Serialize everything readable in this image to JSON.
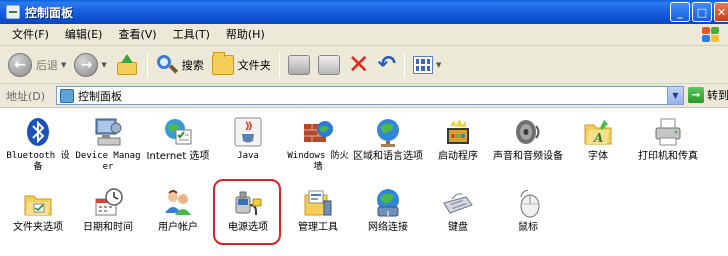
{
  "window": {
    "title": "控制面板"
  },
  "menubar": {
    "items": [
      "文件(F)",
      "编辑(E)",
      "查看(V)",
      "工具(T)",
      "帮助(H)"
    ]
  },
  "toolbar": {
    "back_label": "后退",
    "search_label": "搜索",
    "folders_label": "文件夹"
  },
  "address": {
    "label": "地址(D)",
    "value": "控制面板",
    "go_label": "转到"
  },
  "items": [
    {
      "label": "Bluetooth 设备",
      "icon": "bluetooth-icon"
    },
    {
      "label": "Device Manager",
      "icon": "device-manager-icon"
    },
    {
      "label": "Internet 选项",
      "icon": "internet-options-icon"
    },
    {
      "label": "Java",
      "icon": "java-icon"
    },
    {
      "label": "Windows 防火墙",
      "icon": "firewall-icon"
    },
    {
      "label": "区域和语言选项",
      "icon": "region-language-icon"
    },
    {
      "label": "启动程序",
      "icon": "startup-programs-icon"
    },
    {
      "label": "声音和音频设备",
      "icon": "sound-audio-icon"
    },
    {
      "label": "字体",
      "icon": "fonts-folder-icon"
    },
    {
      "label": "打印机和传真",
      "icon": "printer-fax-icon"
    },
    {
      "label": "文件夹选项",
      "icon": "folder-options-icon"
    },
    {
      "label": "日期和时间",
      "icon": "date-time-icon"
    },
    {
      "label": "用户帐户",
      "icon": "user-accounts-icon"
    },
    {
      "label": "电源选项",
      "icon": "power-options-icon"
    },
    {
      "label": "管理工具",
      "icon": "admin-tools-icon"
    },
    {
      "label": "网络连接",
      "icon": "network-connections-icon"
    },
    {
      "label": "键盘",
      "icon": "keyboard-icon"
    },
    {
      "label": "鼠标",
      "icon": "mouse-icon"
    }
  ],
  "highlighted_item": "电源选项",
  "colors": {
    "title_bar": "#0a5fd8",
    "chrome": "#ece9d8",
    "highlight_ring": "#e02020"
  }
}
